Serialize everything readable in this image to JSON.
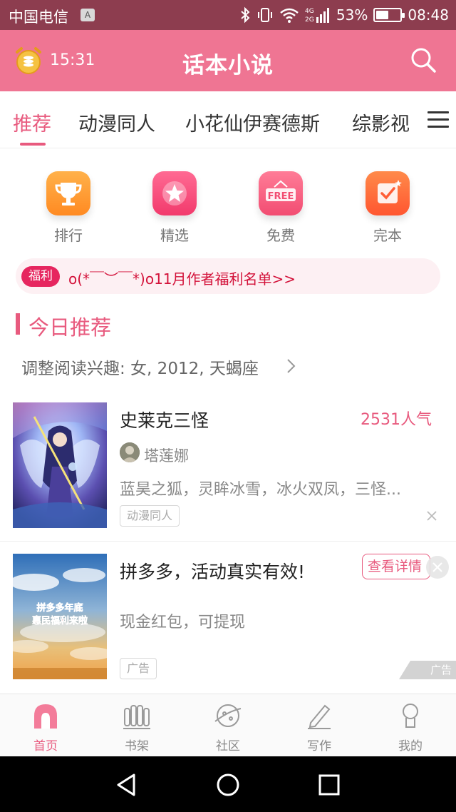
{
  "status_bar": {
    "carrier": "中国电信",
    "sim_badge": "A",
    "network": "4G 2G",
    "battery": "53%",
    "battery_level": 0.53,
    "time": "08:48"
  },
  "header": {
    "timer": "15:31",
    "title": "话本小说"
  },
  "tabs": [
    {
      "label": "推荐",
      "active": true
    },
    {
      "label": "动漫同人"
    },
    {
      "label": "小花仙伊赛德斯"
    },
    {
      "label": "综影视"
    }
  ],
  "categories": [
    {
      "label": "排行",
      "icon": "trophy-icon",
      "color": "#ff9a2e"
    },
    {
      "label": "精选",
      "icon": "star-icon",
      "color": "#f6497a"
    },
    {
      "label": "免费",
      "icon": "free-tag-icon",
      "color": "#f65a7c",
      "icon_text": "FREE"
    },
    {
      "label": "完本",
      "icon": "check-icon",
      "color": "#ff6a3b"
    }
  ],
  "welfare": {
    "badge": "福利",
    "text": "o(*￣︶￣*)o11月作者福利名单>>"
  },
  "section": {
    "title": "今日推荐",
    "interest": "调整阅读兴趣: 女, 2012, 天蝎座"
  },
  "book": {
    "title": "史莱克三怪",
    "popularity": "2531人气",
    "author": "塔莲娜",
    "description": "蓝昊之狐，灵眸冰雪，冰火双凤，三怪...",
    "tag": "动漫同人"
  },
  "ad": {
    "title": "拼多多，活动真实有效!",
    "description": "现金红包，可提现",
    "tag": "广告",
    "button": "查看详情",
    "watermark": "广告",
    "cover_line1": "拼多多年底",
    "cover_line2": "惠民福利来啦"
  },
  "bottom_nav": [
    {
      "label": "首页",
      "icon": "home-icon",
      "active": true
    },
    {
      "label": "书架",
      "icon": "bookshelf-icon"
    },
    {
      "label": "社区",
      "icon": "community-icon"
    },
    {
      "label": "写作",
      "icon": "write-icon"
    },
    {
      "label": "我的",
      "icon": "profile-icon"
    }
  ],
  "colors": {
    "accent": "#e85a7e",
    "header": "#ef7593",
    "status_bar": "#8d3d4f"
  }
}
